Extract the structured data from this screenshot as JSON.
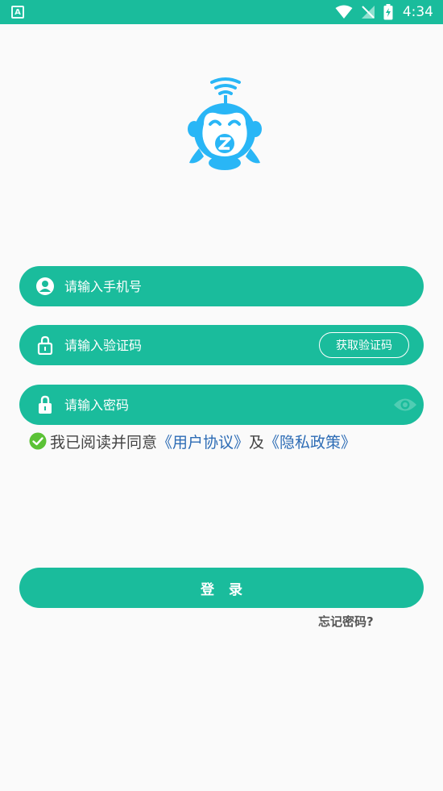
{
  "status_bar": {
    "app_indicator": "A",
    "time": "4:34"
  },
  "form": {
    "phone_placeholder": "请输入手机号",
    "code_placeholder": "请输入验证码",
    "get_code_label": "获取验证码",
    "password_placeholder": "请输入密码"
  },
  "agreement": {
    "prefix": "我已阅读并同意",
    "user_agreement": "《用户协议》",
    "conjunction": "及",
    "privacy_policy": "《隐私政策》"
  },
  "login_label": "登录",
  "forgot_label": "忘记密码?",
  "colors": {
    "accent": "#1abc9c",
    "logo": "#29b6f6",
    "link": "#2d6cb5",
    "check": "#5bc236"
  }
}
